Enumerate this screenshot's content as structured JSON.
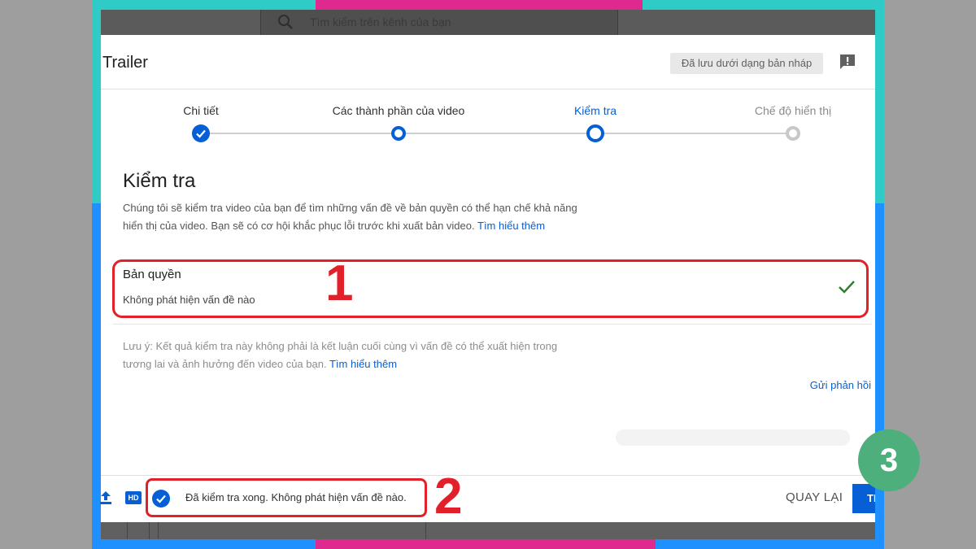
{
  "colors": {
    "accent": "#065fd4",
    "annotation_red": "#e2202a",
    "success_green": "#2e7d32",
    "frame_teal": "#2ecbc7",
    "frame_blue": "#1e90ff",
    "frame_pink": "#e0298f",
    "badge_green": "#4caf7c"
  },
  "search": {
    "placeholder": "Tìm kiếm trên kênh của bạn",
    "icon": "search-icon"
  },
  "dialog": {
    "title": "Trailer",
    "draft_status": "Đã lưu dưới dạng bản nháp",
    "feedback_icon": "feedback-icon"
  },
  "stepper": {
    "steps": [
      {
        "label": "Chi tiết",
        "state": "done"
      },
      {
        "label": "Các thành phần của video",
        "state": "done"
      },
      {
        "label": "Kiểm tra",
        "state": "active"
      },
      {
        "label": "Chế độ hiển thị",
        "state": "upcoming"
      }
    ]
  },
  "checks": {
    "heading": "Kiểm tra",
    "description": "Chúng tôi sẽ kiểm tra video của bạn để tìm những vấn đề về bản quyền có thể hạn chế khả năng hiển thị của video. Bạn sẽ có cơ hội khắc phục lỗi trước khi xuất bản video.",
    "learn_more": "Tìm hiểu thêm",
    "copyright": {
      "title": "Bản quyền",
      "status": "Không phát hiện vấn đề nào"
    },
    "note": "Lưu ý: Kết quả kiểm tra này không phải là kết luận cuối cùng vì vấn đề có thể xuất hiện trong tương lai và ảnh hưởng đến video của bạn.",
    "note_link": "Tìm hiểu thêm",
    "send_feedback": "Gửi phản hồi"
  },
  "footer": {
    "hd_label": "HD",
    "status": "Đã kiểm tra xong. Không phát hiện vấn đề nào.",
    "back": "QUAY LẠI",
    "next": "TI"
  },
  "annotations": {
    "one": "1",
    "two": "2",
    "three": "3"
  }
}
